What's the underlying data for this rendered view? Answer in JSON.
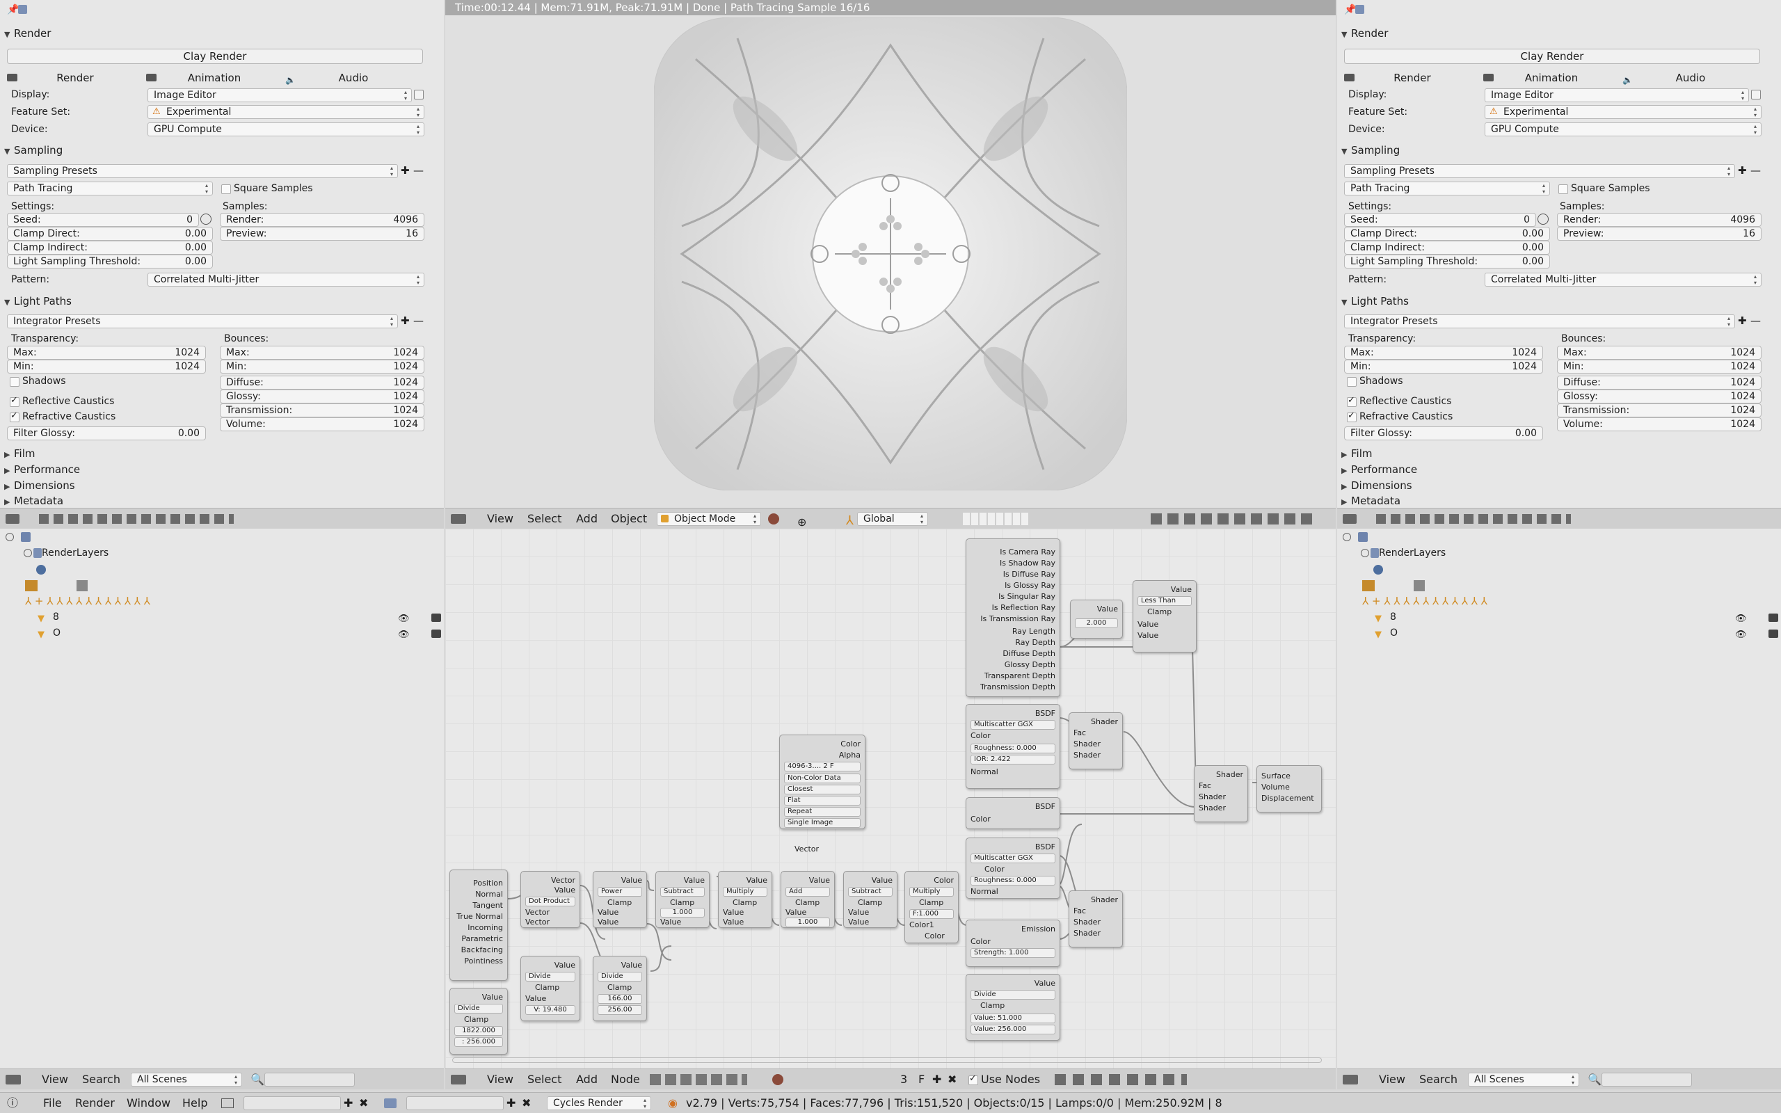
{
  "render_panel": {
    "sections": {
      "render": "Render",
      "sampling": "Sampling",
      "light_paths": "Light Paths",
      "film": "Film",
      "performance": "Performance",
      "dimensions": "Dimensions",
      "metadata": "Metadata"
    },
    "clay_render": "Clay Render",
    "render_btn": "Render",
    "animation_btn": "Animation",
    "audio_btn": "Audio",
    "display_label": "Display:",
    "display_value": "Image Editor",
    "feature_label": "Feature Set:",
    "feature_value": "Experimental",
    "device_label": "Device:",
    "device_value": "GPU Compute",
    "sampling_presets": "Sampling Presets",
    "integrator": "Path Tracing",
    "square_samples": "Square Samples",
    "settings_label": "Settings:",
    "samples_label": "Samples:",
    "seed_label": "Seed:",
    "seed_value": "0",
    "clamp_direct_label": "Clamp Direct:",
    "clamp_direct_value": "0.00",
    "clamp_indirect_label": "Clamp Indirect:",
    "clamp_indirect_value": "0.00",
    "lst_label": "Light Sampling Threshold:",
    "lst_value": "0.00",
    "render_samples_label": "Render:",
    "render_samples_value": "4096",
    "preview_label": "Preview:",
    "preview_value": "16",
    "pattern_label": "Pattern:",
    "pattern_value": "Correlated Multi-Jitter",
    "integrator_presets": "Integrator Presets",
    "transparency_label": "Transparency:",
    "bounces_label": "Bounces:",
    "max_label": "Max:",
    "min_label": "Min:",
    "t_max": "1024",
    "t_min": "1024",
    "b_max": "1024",
    "b_min": "1024",
    "shadows": "Shadows",
    "diffuse_label": "Diffuse:",
    "diffuse_value": "1024",
    "glossy_label": "Glossy:",
    "glossy_value": "1024",
    "transmission_label": "Transmission:",
    "transmission_value": "1024",
    "volume_label": "Volume:",
    "volume_value": "1024",
    "reflective_caustics": "Reflective Caustics",
    "refractive_caustics": "Refractive Caustics",
    "filter_glossy_label": "Filter Glossy:",
    "filter_glossy_value": "0.00"
  },
  "viewport": {
    "status": "Time:00:12.44 | Mem:71.91M, Peak:71.91M | Done | Path Tracing Sample 16/16",
    "menu": [
      "View",
      "Select",
      "Add",
      "Object"
    ],
    "mode": "Object Mode",
    "orientation": "Global"
  },
  "outliner": {
    "renderlayers": "RenderLayers",
    "row8": "8",
    "rowO": "O",
    "menu": [
      "View",
      "Search"
    ],
    "scenes": "All Scenes"
  },
  "node_editor": {
    "menu": [
      "View",
      "Select",
      "Add",
      "Node"
    ],
    "users": "3",
    "fake": "F",
    "use_nodes": "Use Nodes"
  },
  "nodes": {
    "lightpath": [
      "Is Camera Ray",
      "Is Shadow Ray",
      "Is Diffuse Ray",
      "Is Glossy Ray",
      "Is Singular Ray",
      "Is Reflection Ray",
      "Is Transmission Ray",
      "Ray Length",
      "Ray Depth",
      "Diffuse Depth",
      "Glossy Depth",
      "Transparent Depth",
      "Transmission Depth"
    ],
    "value_2": "Value",
    "value_2_val": "2.000",
    "less_than_out": "Value",
    "less_than_op": "Less Than",
    "clamp": "Clamp",
    "value": "Value",
    "bsdf": "BSDF",
    "multiscatter": "Multiscatter GGX",
    "color": "Color",
    "roughness_0": "Roughness:",
    "roughness_0_v": "0.000",
    "ior": "IOR:",
    "ior_v": "2.422",
    "normal": "Normal",
    "shader": "Shader",
    "fac": "Fac",
    "surface": "Surface",
    "volume": "Volume",
    "displacement": "Displacement",
    "alpha": "Alpha",
    "image_name": "4096-3....",
    "image_users": "2",
    "image_f": "F",
    "non_color": "Non-Color Data",
    "closest": "Closest",
    "flat": "Flat",
    "repeat": "Repeat",
    "single_image": "Single Image",
    "vector": "Vector",
    "emission": "Emission",
    "strength": "Strength:",
    "strength_v": "1.000",
    "divide": "Divide",
    "value_51": "Value:",
    "value_51_v": "51.000",
    "value_256": "Value:",
    "value_256_v": "256.000",
    "geometry": [
      "Position",
      "Normal",
      "Tangent",
      "True Normal",
      "Incoming",
      "Parametric",
      "Backfacing",
      "Pointiness"
    ],
    "dot_product": "Dot Product",
    "power": "Power",
    "subtract": "Subtract",
    "multiply": "Multiply",
    "add": "Add",
    "one": "1.000",
    "one_b": "1.000",
    "mix_multiply": "Multiply",
    "f_one": "F:1.000",
    "color1": "Color1",
    "v1822": "1822.000",
    "v256": ": 256.000",
    "v19480": "V: 19.480",
    "v166": "166.00",
    "v256b": "256.00"
  },
  "info_bar": {
    "menu": [
      "File",
      "Render",
      "Window",
      "Help"
    ],
    "engine": "Cycles Render",
    "stats": "v2.79 | Verts:75,754 | Faces:77,796 | Tris:151,520 | Objects:0/15 | Lamps:0/0 | Mem:250.92M | 8"
  },
  "colors": {
    "panel_bg": "#e7e7e7",
    "header_bg": "#cfcfcf",
    "node_bg": "#d9d9d9",
    "socket_yellow": "#e2d145",
    "socket_green": "#3dd36a",
    "socket_purple": "#6464d2",
    "socket_grey": "#8a8a8a"
  }
}
